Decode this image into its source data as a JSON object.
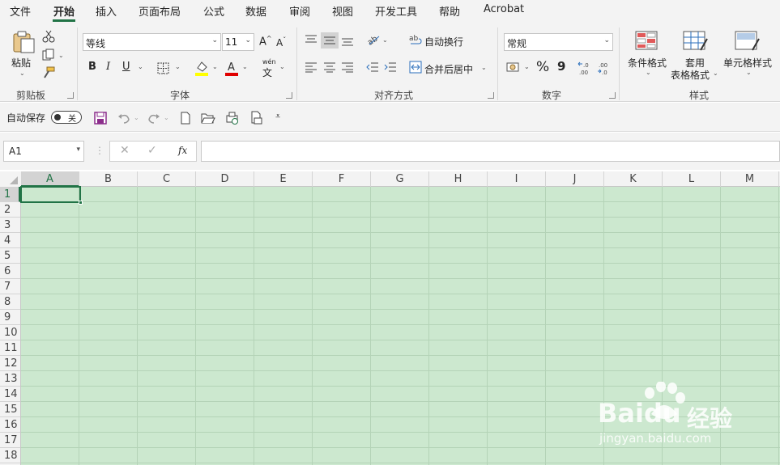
{
  "menu": {
    "tabs": [
      "文件",
      "开始",
      "插入",
      "页面布局",
      "公式",
      "数据",
      "审阅",
      "视图",
      "开发工具",
      "帮助",
      "Acrobat"
    ],
    "active": "开始"
  },
  "ribbon": {
    "clipboard": {
      "paste": "粘贴",
      "group": "剪贴板"
    },
    "font": {
      "name": "等线",
      "size": "11",
      "bold": "B",
      "italic": "I",
      "underline": "U",
      "phonetic": "wén",
      "group": "字体"
    },
    "alignment": {
      "wrap": "自动换行",
      "merge": "合并后居中",
      "group": "对齐方式"
    },
    "number": {
      "format": "常规",
      "percent": "%",
      "comma": "9",
      "group": "数字"
    },
    "styles": {
      "conditional": "条件格式",
      "table_line1": "套用",
      "table_line2": "表格格式",
      "cell": "单元格样式",
      "group": "样式"
    }
  },
  "qat": {
    "autosave": "自动保存",
    "toggle": "关"
  },
  "formula": {
    "namebox": "A1",
    "fx": "fx",
    "value": ""
  },
  "grid": {
    "columns": [
      "A",
      "B",
      "C",
      "D",
      "E",
      "F",
      "G",
      "H",
      "I",
      "J",
      "K",
      "L",
      "M"
    ],
    "rows": [
      "1",
      "2",
      "3",
      "4",
      "5",
      "6",
      "7",
      "8",
      "9",
      "10",
      "11",
      "12",
      "13",
      "14",
      "15",
      "16",
      "17",
      "18"
    ],
    "selected_col": "A",
    "selected_row": "1"
  },
  "watermark": {
    "brand": "Baidu",
    "suffix": "经验",
    "url": "jingyan.baidu.com"
  },
  "colors": {
    "accent": "#217346",
    "cell_bg": "#cce8cf"
  }
}
